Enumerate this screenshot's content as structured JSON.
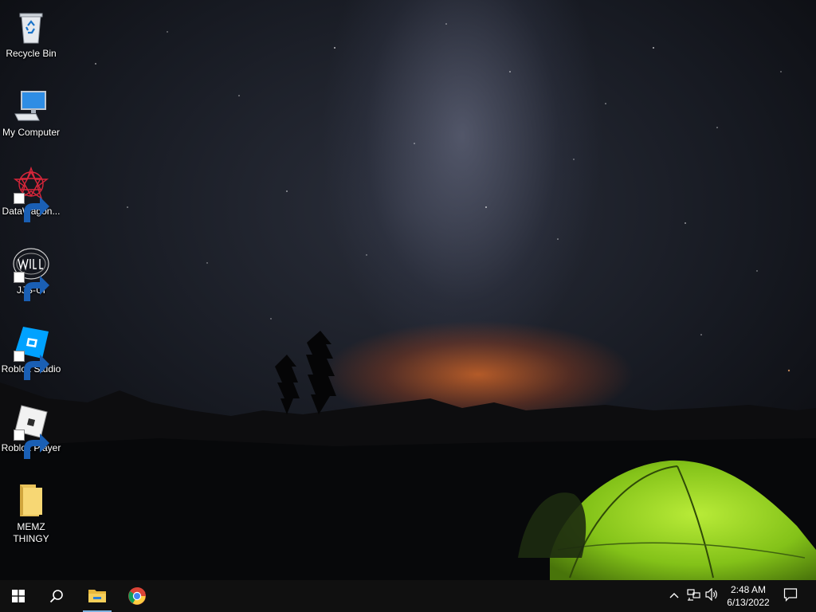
{
  "desktop": {
    "icons": [
      {
        "label": "Recycle Bin",
        "icon": "recycle-bin-icon",
        "shortcut": false
      },
      {
        "label": "My Computer",
        "icon": "computer-icon",
        "shortcut": false
      },
      {
        "label": "DataWagon...",
        "icon": "datawagon-icon",
        "shortcut": true
      },
      {
        "label": "JJS-UI",
        "icon": "jjs-ui-icon",
        "shortcut": true
      },
      {
        "label": "Roblox Studio",
        "icon": "roblox-studio-icon",
        "shortcut": true
      },
      {
        "label": "Roblox Player",
        "icon": "roblox-player-icon",
        "shortcut": true
      },
      {
        "label": "MEMZ THINGY",
        "icon": "folder-icon",
        "shortcut": false
      }
    ],
    "wallpaper": "night sky camping"
  },
  "taskbar": {
    "start": "windows-start-icon",
    "search": "search-icon",
    "pinned": [
      {
        "name": "File Explorer",
        "icon": "file-explorer-icon",
        "active": true
      },
      {
        "name": "Google Chrome",
        "icon": "chrome-icon",
        "active": false
      }
    ],
    "tray": [
      "chevron-up-icon",
      "network-icon",
      "volume-icon"
    ],
    "clock": {
      "time": "2:48 AM",
      "date": "6/13/2022"
    },
    "notifications": "notification-icon"
  }
}
